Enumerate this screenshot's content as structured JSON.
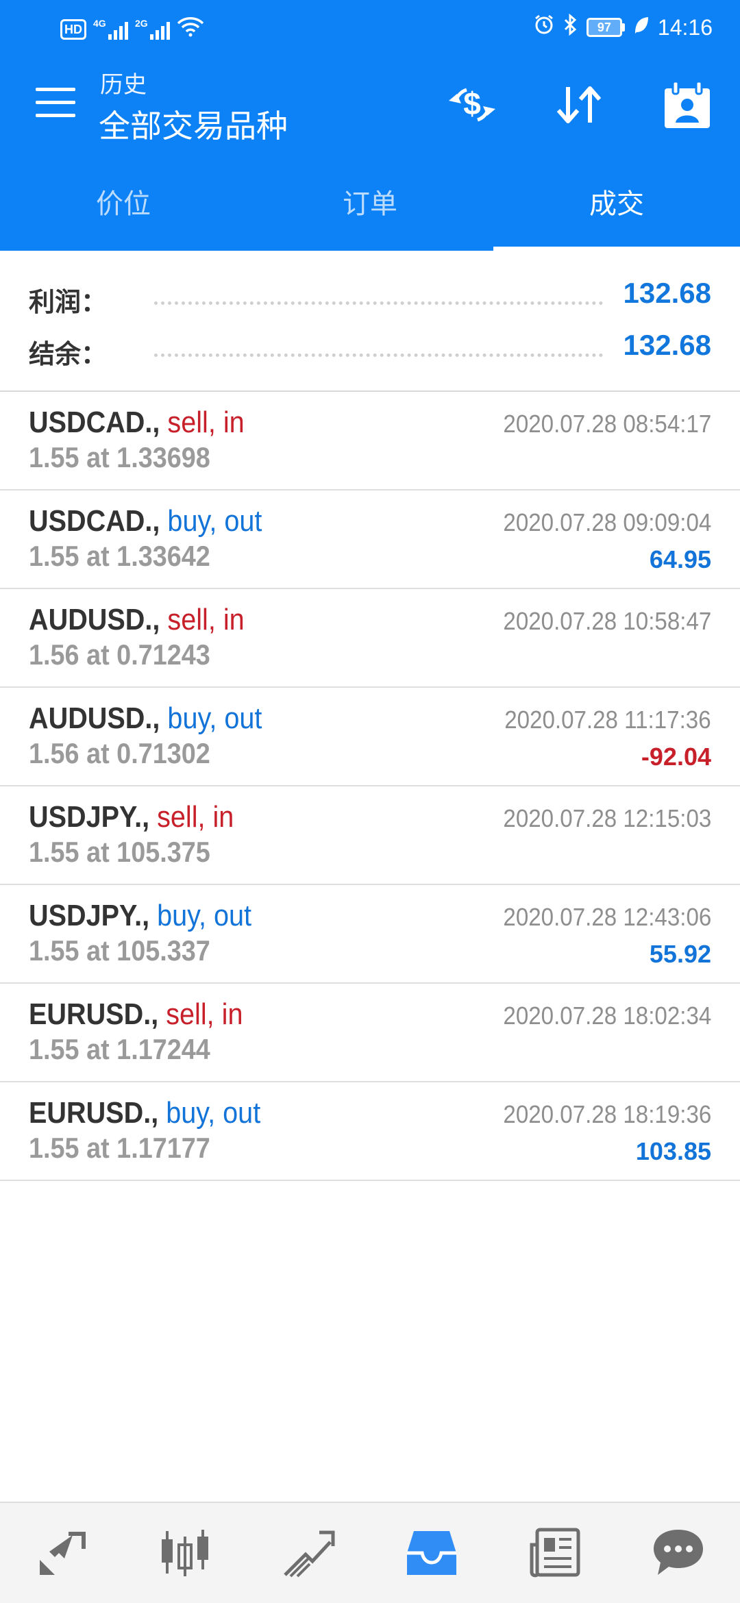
{
  "status_bar": {
    "network_badge": "HD",
    "sim1_label": "4G",
    "sim2_label": "2G",
    "battery": "97",
    "time": "14:16"
  },
  "app_bar": {
    "subtitle": "历史",
    "title": "全部交易品种",
    "icons": [
      "menu-icon",
      "currency-exchange-icon",
      "sort-icon",
      "calendar-contact-icon"
    ]
  },
  "tabs": [
    {
      "label": "价位",
      "active": false
    },
    {
      "label": "订单",
      "active": false
    },
    {
      "label": "成交",
      "active": true
    }
  ],
  "summary": {
    "profit_label": "利润：",
    "profit_value": "132.68",
    "balance_label": "结余：",
    "balance_value": "132.68"
  },
  "deals": [
    {
      "symbol": "USDCAD.,",
      "direction": "sell, in",
      "type": "sell",
      "detail": "1.55 at 1.33698",
      "time": "2020.07.28 08:54:17",
      "profit": ""
    },
    {
      "symbol": "USDCAD.,",
      "direction": "buy, out",
      "type": "buy",
      "detail": "1.55 at 1.33642",
      "time": "2020.07.28 09:09:04",
      "profit": "64.95"
    },
    {
      "symbol": "AUDUSD.,",
      "direction": "sell, in",
      "type": "sell",
      "detail": "1.56 at 0.71243",
      "time": "2020.07.28 10:58:47",
      "profit": ""
    },
    {
      "symbol": "AUDUSD.,",
      "direction": "buy, out",
      "type": "buy",
      "detail": "1.56 at 0.71302",
      "time": "2020.07.28 11:17:36",
      "profit": "-92.04"
    },
    {
      "symbol": "USDJPY.,",
      "direction": "sell, in",
      "type": "sell",
      "detail": "1.55 at 105.375",
      "time": "2020.07.28 12:15:03",
      "profit": ""
    },
    {
      "symbol": "USDJPY.,",
      "direction": "buy, out",
      "type": "buy",
      "detail": "1.55 at 105.337",
      "time": "2020.07.28 12:43:06",
      "profit": "55.92"
    },
    {
      "symbol": "EURUSD.,",
      "direction": "sell, in",
      "type": "sell",
      "detail": "1.55 at 1.17244",
      "time": "2020.07.28 18:02:34",
      "profit": ""
    },
    {
      "symbol": "EURUSD.,",
      "direction": "buy, out",
      "type": "buy",
      "detail": "1.55 at 1.17177",
      "time": "2020.07.28 18:19:36",
      "profit": "103.85"
    }
  ],
  "bottom_nav": {
    "items": [
      "quotes-arrows-icon",
      "candlestick-chart-icon",
      "trade-icon",
      "history-inbox-icon",
      "news-icon",
      "messages-chat-icon"
    ],
    "active": "history-inbox-icon"
  },
  "colors": {
    "header_blue": "#0d82f6",
    "sell_red": "#c8202a",
    "buy_blue": "#1273d8",
    "bottom_nav_active": "#2f8df5"
  }
}
